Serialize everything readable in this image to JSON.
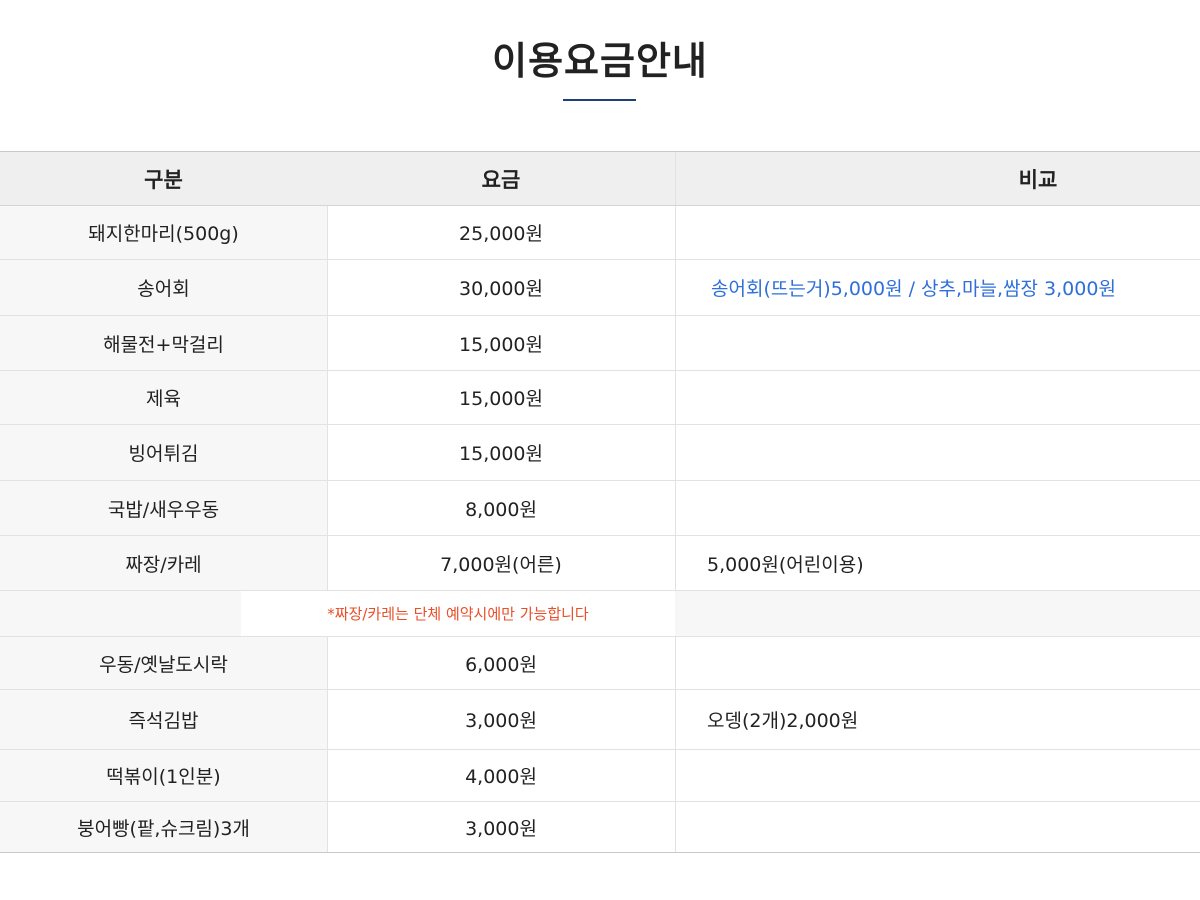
{
  "page": {
    "title": "이용요금안내"
  },
  "table": {
    "headers": [
      "구분",
      "요금",
      "비교"
    ],
    "rows": [
      {
        "item": "돼지한마리(500g)",
        "price": "25,000원",
        "note": ""
      },
      {
        "item": "송어회",
        "price": "30,000원",
        "note": "송어회(뜨는거)5,000원 / 상추,마늘,쌈장 3,000원"
      },
      {
        "item": "해물전+막걸리",
        "price": "15,000원",
        "note": ""
      },
      {
        "item": "제육",
        "price": "15,000원",
        "note": ""
      },
      {
        "item": "빙어튀김",
        "price": "15,000원",
        "note": ""
      },
      {
        "item": "국밥/새우우동",
        "price": "8,000원",
        "note": ""
      },
      {
        "item": "짜장/카레",
        "price": "7,000원(어른)",
        "note": "5,000원(어린이용)"
      },
      {
        "item": "우동/옛날도시락",
        "price": "6,000원",
        "note": ""
      },
      {
        "item": "즉석김밥",
        "price": "3,000원",
        "note": "오뎅(2개)2,000원"
      },
      {
        "item": "떡볶이(1인분)",
        "price": "4,000원",
        "note": ""
      },
      {
        "item": "붕어빵(팥,슈크림)3개",
        "price": "3,000원",
        "note": ""
      }
    ],
    "reservation_note": "*짜장/카레는 단체 예약시에만 가능합니다"
  },
  "colors": {
    "title_underline": "#1f3f7a",
    "note_blue": "#2f6fd9",
    "note_orange": "#e8502a"
  }
}
